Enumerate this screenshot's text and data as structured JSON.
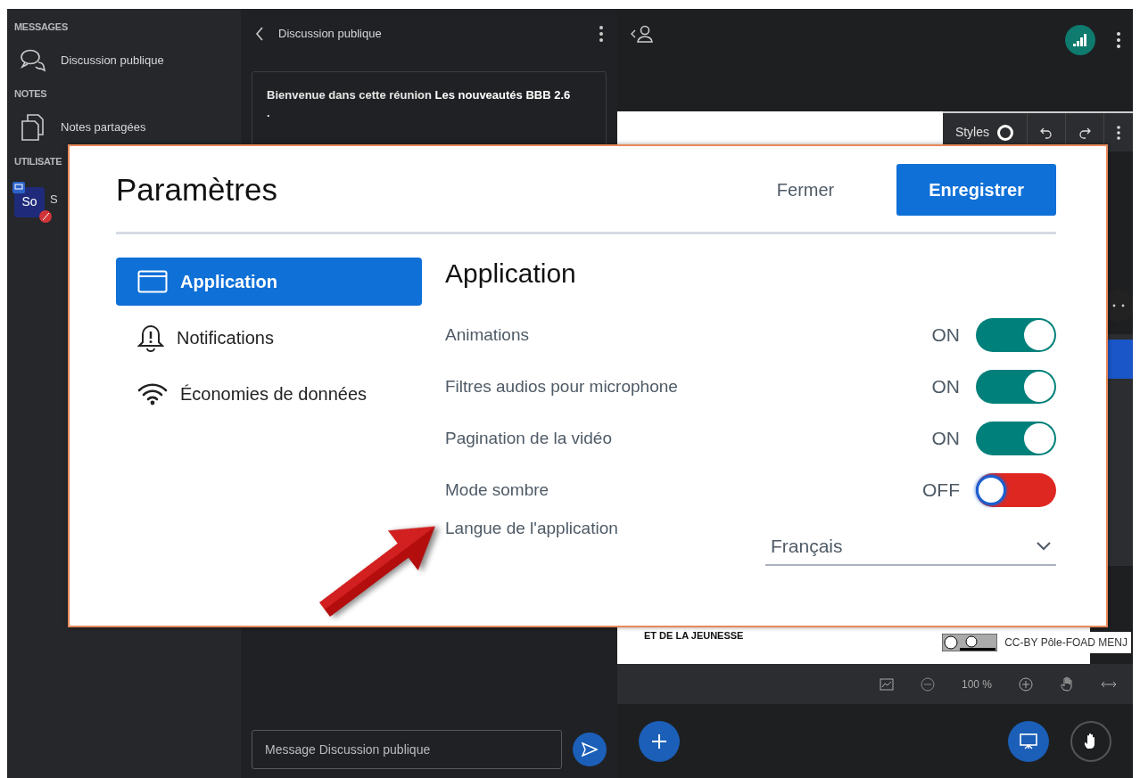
{
  "sidebar": {
    "sections": [
      {
        "title": "MESSAGES",
        "items": [
          {
            "label": "Discussion publique",
            "kind": "chat"
          }
        ]
      },
      {
        "title": "NOTES",
        "items": [
          {
            "label": "Notes partagées",
            "kind": "notes"
          }
        ]
      },
      {
        "title": "UTILISATE",
        "items": [
          {
            "label": "S",
            "kind": "user",
            "avatar": "So"
          }
        ]
      }
    ]
  },
  "chat": {
    "title": "Discussion publique",
    "welcome": "Bienvenue dans cette réunion **Les nouveautés BBB 2.6**\n.",
    "input": {
      "placeholder": "Message Discussion publique"
    }
  },
  "presentation": {
    "toolbar": {
      "styles": "Styles"
    },
    "slide_text": "ET DE LA JEUNESSE",
    "license": "CC-BY Pôle-FOAD MENJ",
    "zoom": "100 %"
  },
  "modal": {
    "title": "Paramètres",
    "buttons": [
      {
        "label": "Fermer",
        "kind": "secondary"
      },
      {
        "label": "Enregistrer",
        "kind": "primary"
      }
    ],
    "menu": [
      {
        "label": "Application",
        "selected": true
      },
      {
        "label": "Notifications",
        "selected": false
      },
      {
        "label": "Économies de données",
        "selected": false
      }
    ],
    "section_title": "Application",
    "settings": [
      {
        "label": "Animations",
        "kind": "toggle",
        "on": true,
        "state_text": "ON"
      },
      {
        "label": "Filtres audios pour microphone",
        "kind": "toggle",
        "on": true,
        "state_text": "ON"
      },
      {
        "label": "Pagination de la vidéo",
        "kind": "toggle",
        "on": true,
        "state_text": "ON"
      },
      {
        "label": "Mode sombre",
        "kind": "toggle",
        "on": false,
        "state_text": "OFF"
      },
      {
        "label": "Langue de l'application",
        "kind": "select",
        "value": "Français"
      }
    ]
  }
}
